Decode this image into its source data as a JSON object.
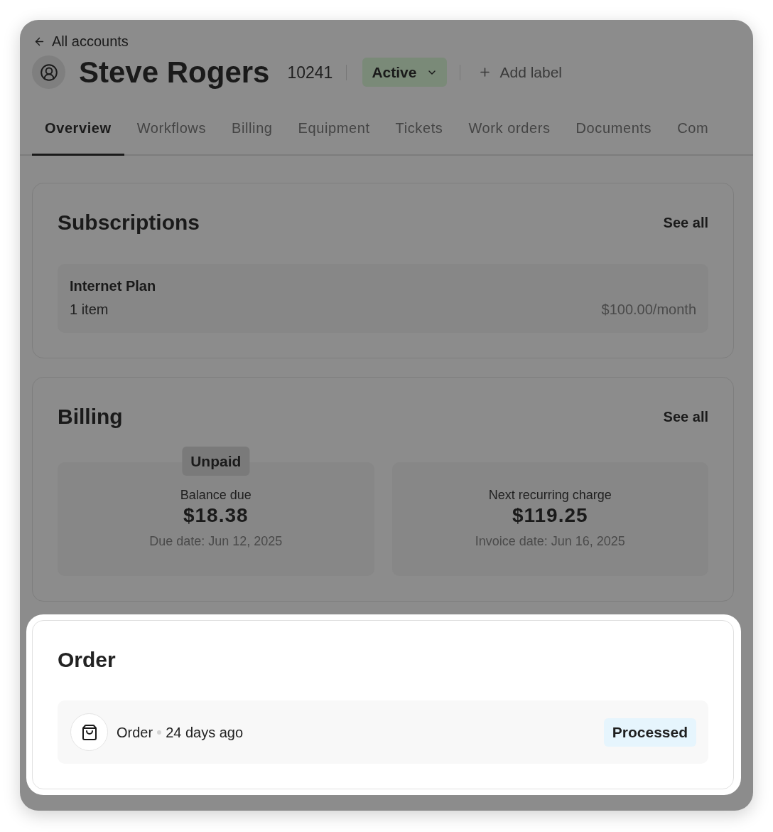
{
  "back_link": {
    "label": "All accounts"
  },
  "account": {
    "name": "Steve Rogers",
    "number": "10241",
    "status": "Active",
    "add_label": "Add label"
  },
  "tabs": [
    {
      "label": "Overview",
      "selected": true
    },
    {
      "label": "Workflows",
      "selected": false
    },
    {
      "label": "Billing",
      "selected": false
    },
    {
      "label": "Equipment",
      "selected": false
    },
    {
      "label": "Tickets",
      "selected": false
    },
    {
      "label": "Work orders",
      "selected": false
    },
    {
      "label": "Documents",
      "selected": false
    },
    {
      "label": "Com",
      "selected": false
    }
  ],
  "subscriptions": {
    "title": "Subscriptions",
    "see_all": "See all",
    "items": [
      {
        "name": "Internet Plan",
        "count": "1 item",
        "price": "$100.00/month"
      }
    ]
  },
  "billing": {
    "title": "Billing",
    "see_all": "See all",
    "tiles": [
      {
        "badge": "Unpaid",
        "label": "Balance due",
        "amount": "$18.38",
        "date": "Due date: Jun 12, 2025"
      },
      {
        "label": "Next recurring charge",
        "amount": "$119.25",
        "date": "Invoice date: Jun 16, 2025"
      }
    ]
  },
  "order": {
    "highlighted": true,
    "title": "Order",
    "items": [
      {
        "label": "Order",
        "age": "24 days ago",
        "status": "Processed"
      }
    ]
  }
}
